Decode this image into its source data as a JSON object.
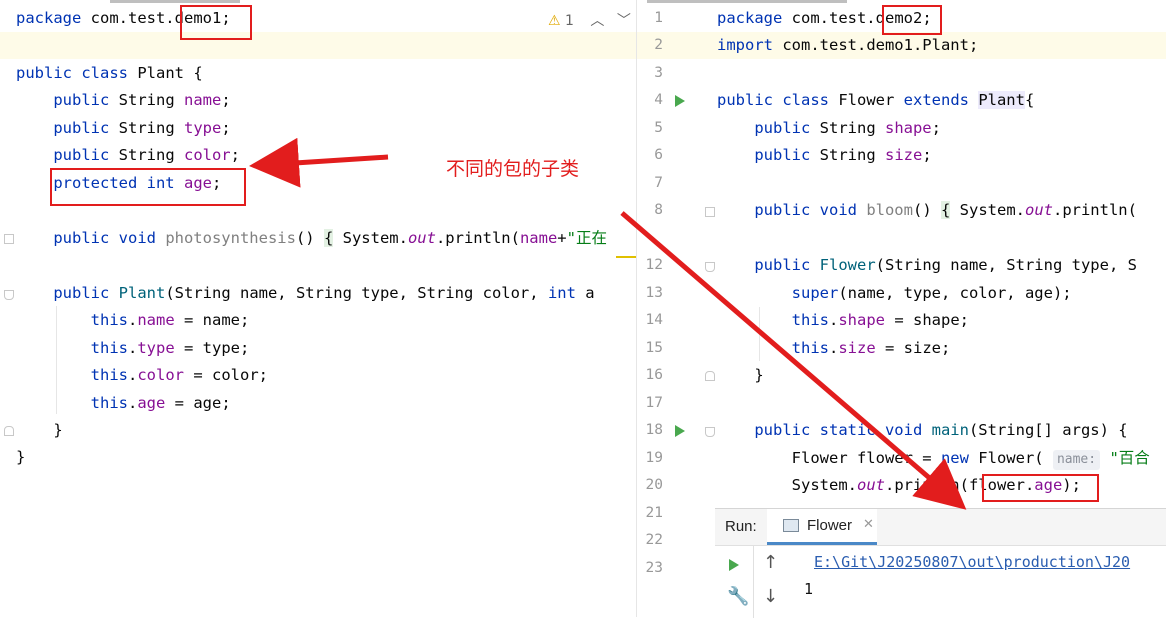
{
  "left_editor": {
    "warning_count": "1",
    "lines": [
      [
        "package com.test.",
        "demo1",
        ";"
      ],
      [],
      [
        "public class Plant {"
      ],
      [
        "    public String ",
        "name",
        ";"
      ],
      [
        "    public String ",
        "type",
        ";"
      ],
      [
        "    public String ",
        "color",
        ";"
      ],
      [
        "    protected int ",
        "age",
        ";"
      ],
      [],
      [
        "    public void ",
        "photosynthesis",
        "() { System.",
        "out",
        ".println(",
        "name",
        "+\"正在"
      ],
      [],
      [
        "    public ",
        "Plant",
        "(String name, String type, String color, int a"
      ],
      [
        "        this.",
        "name",
        " = name;"
      ],
      [
        "        this.",
        "type",
        " = type;"
      ],
      [
        "        this.",
        "color",
        " = color;"
      ],
      [
        "        this.",
        "age",
        " = age;"
      ],
      [
        "    }"
      ],
      [
        "}"
      ]
    ]
  },
  "right_editor": {
    "line_numbers": [
      "1",
      "2",
      "3",
      "4",
      "5",
      "6",
      "7",
      "8",
      "12",
      "13",
      "14",
      "15",
      "16",
      "17",
      "18",
      "19",
      "20",
      "21",
      "22",
      "23"
    ],
    "code": {
      "l1a": "package com.test.",
      "l1b": "demo2",
      "l1c": ";",
      "l2": "import com.test.demo1.Plant;",
      "l4a": "public class Flower extends ",
      "l4b": "Plant",
      "l4c": "{",
      "l5a": "    public String ",
      "l5b": "shape",
      "l5c": ";",
      "l6a": "    public String ",
      "l6b": "size",
      "l6c": ";",
      "l8a": "    public void ",
      "l8b": "bloom",
      "l8c": "() { System.",
      "l8d": "out",
      "l8e": ".println(",
      "l12a": "    public ",
      "l12b": "Flower",
      "l12c": "(String name, String type, S",
      "l13a": "        super",
      "l13b": "(name, type, color, age);",
      "l14a": "        this.",
      "l14b": "shape",
      "l14c": " = shape;",
      "l15a": "        this.",
      "l15b": "size",
      "l15c": " = size;",
      "l16": "    }",
      "l18a": "    public static void ",
      "l18b": "main",
      "l18c": "(String[] args) {",
      "l19a": "        Flower flower = new Flower(",
      "l19hint": "name:",
      "l19c": "\"百合",
      "l20a": "        System.",
      "l20b": "out",
      "l20c": ".println(",
      "l20d": "flower.",
      "l20e": "age",
      "l20f": ");"
    }
  },
  "annotation": {
    "label": "不同的包的子类"
  },
  "run_panel": {
    "run_label": "Run:",
    "tab_label": "Flower",
    "output_path": "E:\\Git\\J20250807\\out\\production\\J20",
    "output_value": "1"
  },
  "colors": {
    "keyword": "#0033b3",
    "field": "#871094",
    "method": "#00627a",
    "string": "#067d17",
    "annotation_red": "#e21d1d",
    "run_green": "#49a84e"
  }
}
